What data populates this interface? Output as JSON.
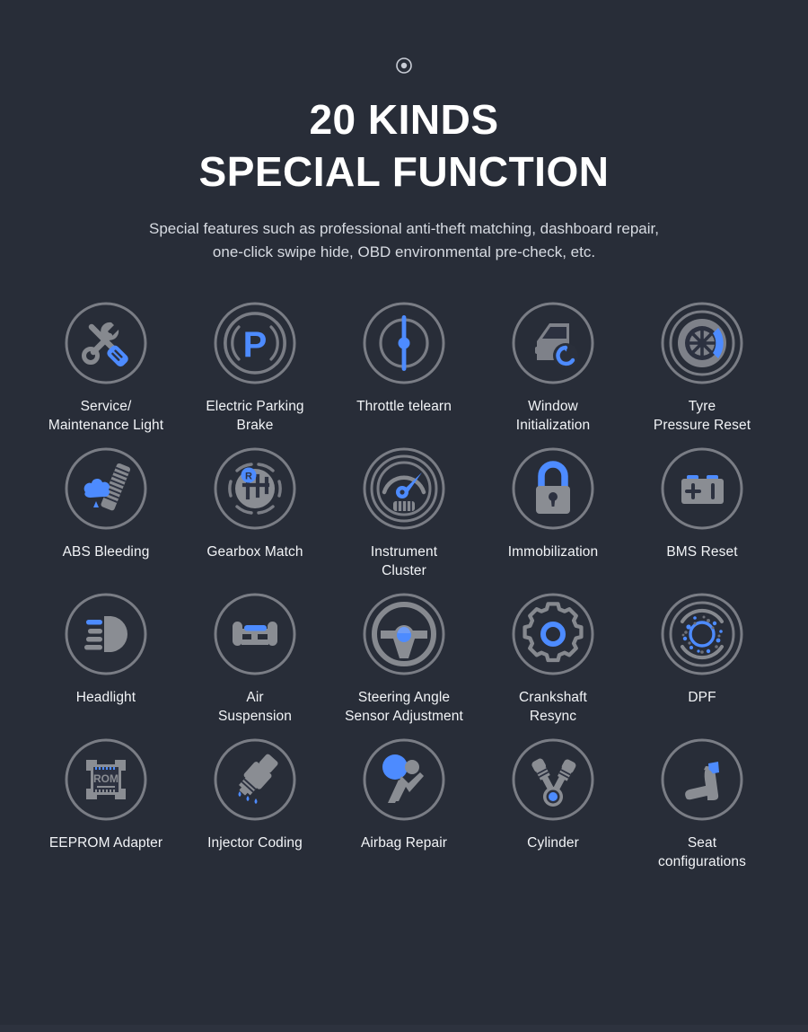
{
  "theme": {
    "background": "#282d38",
    "accent_blue": "#4d8bff",
    "icon_gray": "#7e8189",
    "ring_gray": "#7a7d85",
    "label_color": "#f2f4f7",
    "title_color": "#ffffff"
  },
  "header": {
    "mark_icon": "bullseye-icon",
    "title_line_1": "20 KINDS",
    "title_line_2": "SPECIAL FUNCTION",
    "subtitle_line_1": "Special features such as professional anti-theft matching, dashboard repair,",
    "subtitle_line_2": "one-click swipe hide, OBD environmental pre-check, etc."
  },
  "functions": [
    {
      "label": "Service/\nMaintenance Light",
      "icon": "wrench-screwdriver-icon"
    },
    {
      "label": "Electric Parking\nBrake",
      "icon": "parking-brake-p-icon"
    },
    {
      "label": "Throttle telearn",
      "icon": "throttle-needle-icon"
    },
    {
      "label": "Window\nInitialization",
      "icon": "car-door-refresh-icon"
    },
    {
      "label": "Tyre\nPressure Reset",
      "icon": "tyre-pressure-icon"
    },
    {
      "label": "ABS Bleeding",
      "icon": "abs-bleeding-icon"
    },
    {
      "label": "Gearbox Match",
      "icon": "gear-shifter-r-icon"
    },
    {
      "label": "Instrument\nCluster",
      "icon": "instrument-cluster-icon"
    },
    {
      "label": "Immobilization",
      "icon": "padlock-icon"
    },
    {
      "label": "BMS Reset",
      "icon": "battery-icon"
    },
    {
      "label": "Headlight",
      "icon": "headlight-beam-icon"
    },
    {
      "label": "Air\nSuspension",
      "icon": "air-suspension-axle-icon"
    },
    {
      "label": "Steering Angle\nSensor Adjustment",
      "icon": "steering-wheel-icon"
    },
    {
      "label": "Crankshaft\nResync",
      "icon": "gear-cog-icon"
    },
    {
      "label": "DPF",
      "icon": "dpf-particulate-icon"
    },
    {
      "label": "EEPROM Adapter",
      "icon": "rom-chip-icon"
    },
    {
      "label": "Injector Coding",
      "icon": "fuel-injector-icon"
    },
    {
      "label": "Airbag Repair",
      "icon": "airbag-icon"
    },
    {
      "label": "Cylinder",
      "icon": "v-piston-icon"
    },
    {
      "label": "Seat\nconfigurations",
      "icon": "car-seat-icon"
    }
  ]
}
